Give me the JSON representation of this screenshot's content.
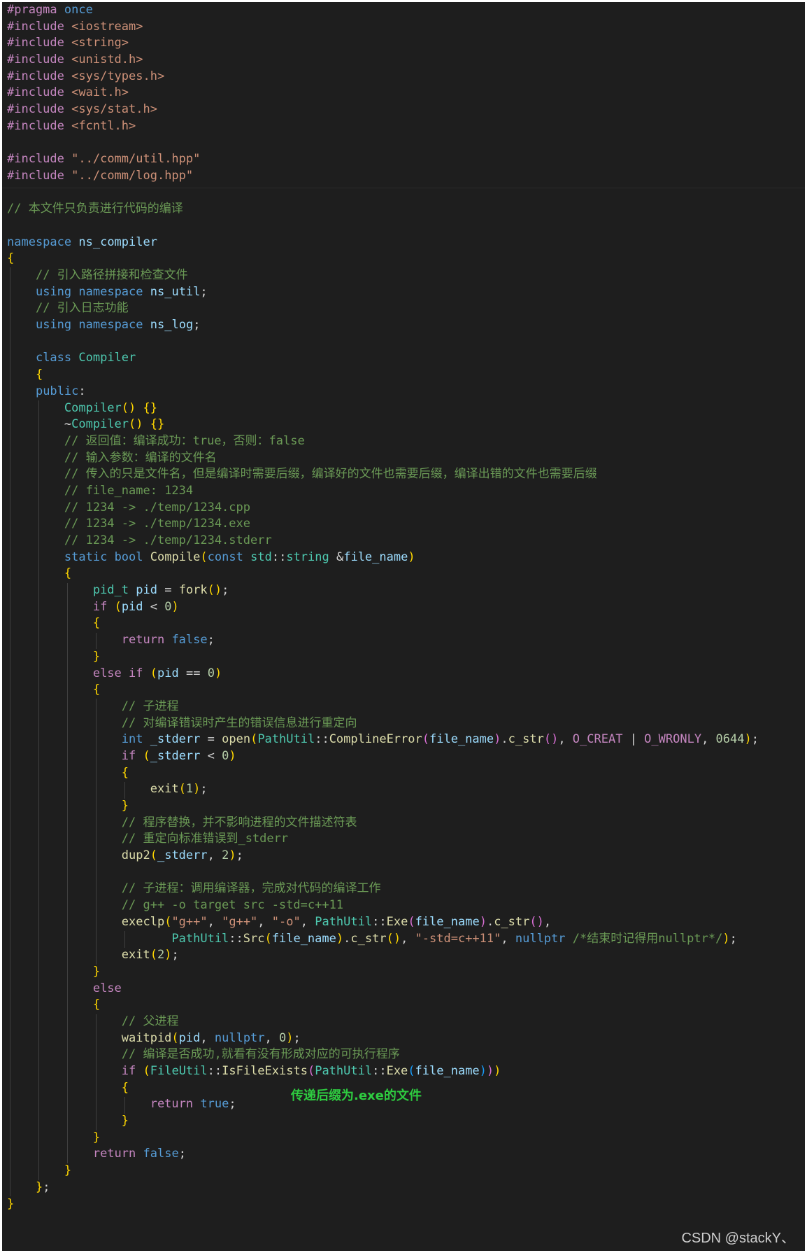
{
  "editor": {
    "lines": [
      "#pragma once",
      "#include <iostream>",
      "#include <string>",
      "#include <unistd.h>",
      "#include <sys/types.h>",
      "#include <wait.h>",
      "#include <sys/stat.h>",
      "#include <fcntl.h>",
      "",
      "#include \"../comm/util.hpp\"",
      "#include \"../comm/log.hpp\"",
      "",
      "// 本文件只负责进行代码的编译",
      "",
      "namespace ns_compiler",
      "{",
      "    // 引入路径拼接和检查文件",
      "    using namespace ns_util;",
      "    // 引入日志功能",
      "    using namespace ns_log;",
      "",
      "    class Compiler",
      "    {",
      "    public:",
      "        Compiler() {}",
      "        ~Compiler() {}",
      "        // 返回值：编译成功：true，否则：false",
      "        // 输入参数：编译的文件名",
      "        // 传入的只是文件名，但是编译时需要后缀，编译好的文件也需要后缀，编译出错的文件也需要后缀",
      "        // file_name: 1234",
      "        // 1234 -> ./temp/1234.cpp",
      "        // 1234 -> ./temp/1234.exe",
      "        // 1234 -> ./temp/1234.stderr",
      "        static bool Compile(const std::string &file_name)",
      "        {",
      "            pid_t pid = fork();",
      "            if (pid < 0)",
      "            {",
      "                return false;",
      "            }",
      "            else if (pid == 0)",
      "            {",
      "                // 子进程",
      "                // 对编译错误时产生的错误信息进行重定向",
      "                int _stderr = open(PathUtil::ComplineError(file_name).c_str(), O_CREAT | O_WRONLY, 0644);",
      "                if (_stderr < 0)",
      "                {",
      "                    exit(1);",
      "                }",
      "                // 程序替换，并不影响进程的文件描述符表",
      "                // 重定向标准错误到_stderr",
      "                dup2(_stderr, 2);",
      "",
      "                // 子进程：调用编译器，完成对代码的编译工作",
      "                // g++ -o target src -std=c++11",
      "                execlp(\"g++\", \"g++\", \"-o\", PathUtil::Exe(file_name).c_str(),",
      "                       PathUtil::Src(file_name).c_str(), \"-std=c++11\", nullptr /*结束时记得用nullptr*/);",
      "                exit(2);",
      "            }",
      "            else",
      "            {",
      "                // 父进程",
      "                waitpid(pid, nullptr, 0);",
      "                // 编译是否成功,就看有没有形成对应的可执行程序",
      "                if (FileUtil::IsFileExists(PathUtil::Exe(file_name)))",
      "                {",
      "                    return true;",
      "                }",
      "            }",
      "            return false;",
      "        }",
      "    };",
      "}"
    ],
    "annotation": "传递后缀为.exe的文件",
    "watermark": "CSDN @stackY、"
  }
}
